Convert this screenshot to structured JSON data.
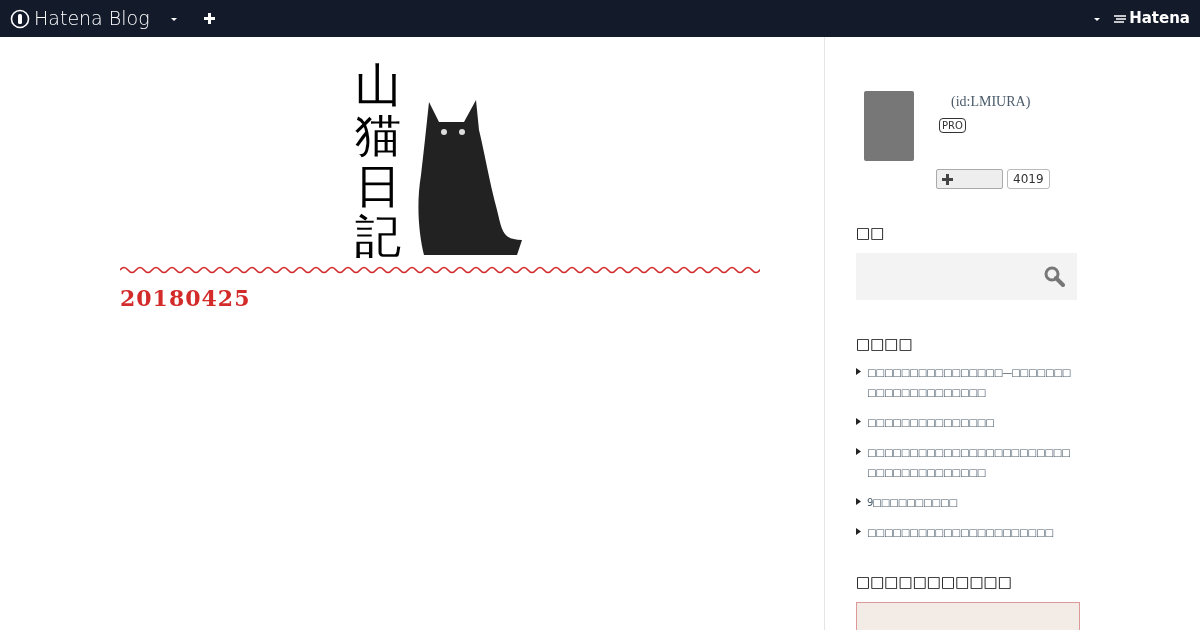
{
  "topbar": {
    "brand": "Hatena Blog",
    "right_brand": "Hatena"
  },
  "header": {
    "title": "山猫日記"
  },
  "entry": {
    "date": "20180425"
  },
  "profile": {
    "id": "(id:LMIURA)",
    "badge": "PRO",
    "count": "4019"
  },
  "search": {
    "heading": "□□"
  },
  "recent": {
    "heading": "□□□□",
    "items": [
      {
        "text": "□□□□□□□□□□□□□□□□—□□□□□□□□□□□□□□□□□□□□□"
      },
      {
        "text": "□□□□□□□□□□□□□□□"
      },
      {
        "text": "□□□□□□□□□□□□□□□□□□□□□□□□□□□□□□□□□□□□□□"
      },
      {
        "text": "9□□□□□□□□□□"
      },
      {
        "text": "□□□□□□□□□□□□□□□□□□□□□□"
      }
    ]
  },
  "ad": {
    "heading": "□□□□□□□□□□□"
  }
}
